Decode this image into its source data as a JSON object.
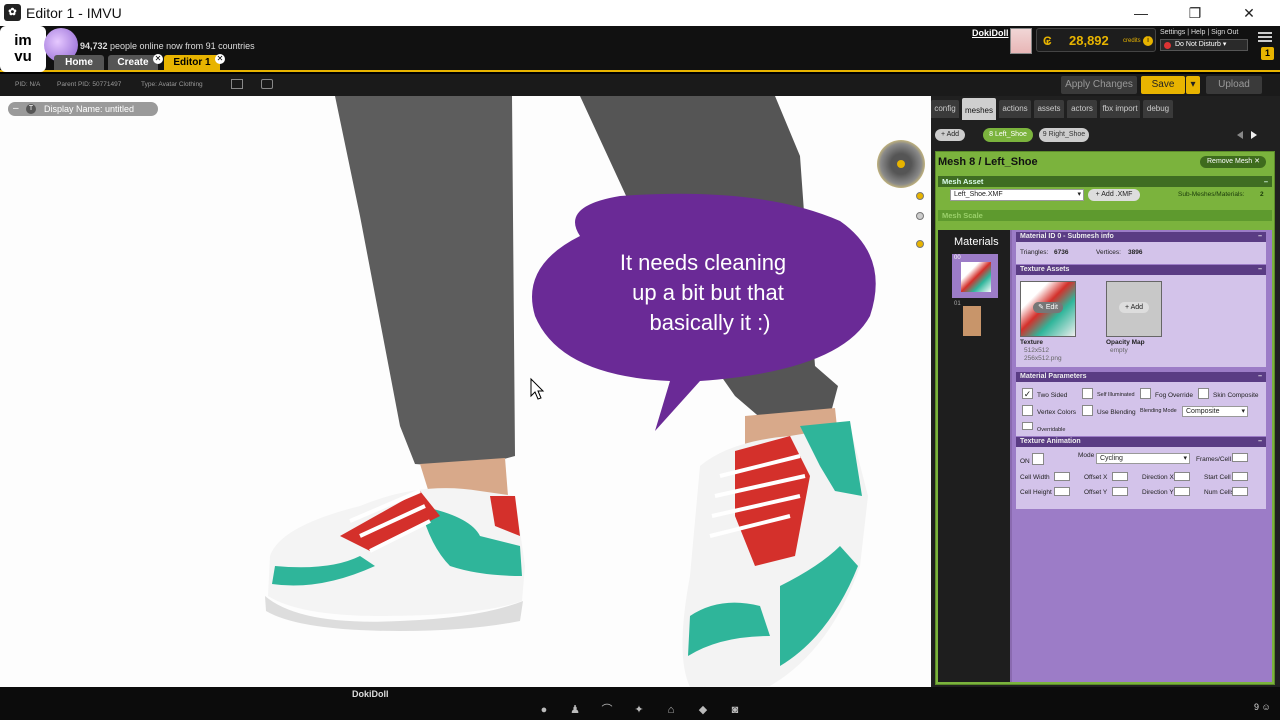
{
  "window": {
    "title": "Editor 1 - IMVU",
    "minimize": "—",
    "restore": "❐",
    "close": "✕"
  },
  "topbar": {
    "logo_text_top": "im",
    "logo_text_bottom": "vu",
    "online_prefix": "94,732",
    "online_text": " people online now from 91 countries",
    "tabs": [
      {
        "label": "Home"
      },
      {
        "label": "Create"
      },
      {
        "label": "Editor 1"
      }
    ],
    "username": "DokiDoll",
    "credits_symbol": "₢",
    "credits_value": "28,892",
    "credits_label": "credits",
    "account_links": "Settings | Help | Sign Out",
    "status": "Do Not Disturb ▾",
    "notification_count": "1"
  },
  "infobar": {
    "pid": "PID: N/A",
    "parent_pid": "Parent PID: 50771497",
    "type": "Type: Avatar Clothing",
    "apply_changes": "Apply Changes",
    "save": "Save",
    "save_arrow": "▾",
    "upload": "Upload"
  },
  "viewport": {
    "display_name": "Display Name: untitled",
    "display_name_icon": "T",
    "minus": "–",
    "bubble_text_lines": [
      "It needs cleaning",
      "up a bit but that",
      "basically it :)"
    ],
    "bubble_color": "#6a2a96"
  },
  "panel": {
    "tabs": [
      "config",
      "meshes",
      "actions",
      "assets",
      "actors",
      "fbx import",
      "debug"
    ],
    "active_tab": "meshes",
    "mesh_add": "+ Add",
    "mesh_tabs": [
      "8 Left_Shoe",
      "9 Right_Shoe"
    ],
    "mesh_title": "Mesh 8 / Left_Shoe",
    "remove_mesh": "Remove Mesh ✕",
    "mesh_asset_header": "Mesh Asset",
    "mesh_file": "Left_Shoe.XMF",
    "add_xmf": "+ Add .XMF",
    "submeshes_label": "Sub-Meshes/Materials:",
    "submeshes_value": "2",
    "mesh_scale_header": "Mesh Scale",
    "materials_title": "Materials",
    "material_ids": [
      "00",
      "01"
    ],
    "material_info_header": "Material ID 0 - Submesh info",
    "triangles_label": "Triangles:",
    "triangles_value": "6736",
    "vertices_label": "Vertices:",
    "vertices_value": "3896",
    "texture_assets_header": "Texture Assets",
    "texture_label": "Texture",
    "texture_size": "512x512",
    "texture_file": "256x512.png",
    "edit": "✎ Edit",
    "opacity_label": "Opacity Map",
    "opacity_value": "empty",
    "add_opacity": "+ Add",
    "material_params_header": "Material Parameters",
    "params": {
      "two_sided": "Two Sided",
      "self_illuminated": "Self Illuminated",
      "fog_override": "Fog Override",
      "skin_composite": "Skin Composite",
      "vertex_colors": "Vertex Colors",
      "use_blending": "Use Blending",
      "blending_mode_label": "Blending Mode",
      "blending_mode_value": "Composite",
      "overridable": "Overridable"
    },
    "texture_anim_header": "Texture Animation",
    "anim": {
      "on": "ON",
      "mode_label": "Mode",
      "mode_value": "Cycling",
      "frames_cell": "Frames/Cell",
      "cell_width": "Cell Width",
      "offset_x": "Offset X",
      "direction_x": "Direction X",
      "start_cell": "Start Cell",
      "cell_height": "Cell Height",
      "offset_y": "Offset Y",
      "direction_y": "Direction Y",
      "num_cells": "Num Cells"
    },
    "collapse": "–"
  },
  "bottombar": {
    "name": "DokiDoll",
    "count": "9"
  }
}
